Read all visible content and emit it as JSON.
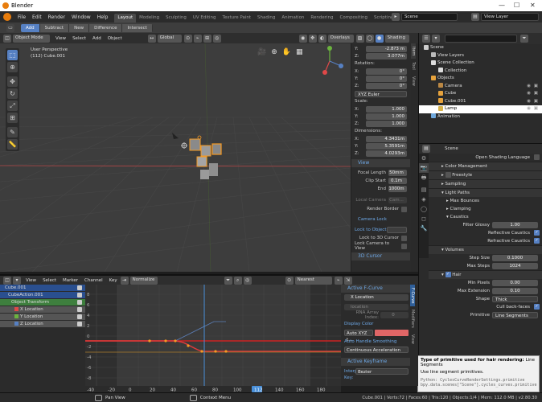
{
  "window": {
    "title": "Blender",
    "controls": [
      "—",
      "☐",
      "✕"
    ]
  },
  "topbar": {
    "menus": [
      "File",
      "Edit",
      "Render",
      "Window",
      "Help"
    ],
    "workspaces": [
      "Layout",
      "Modeling",
      "Sculpting",
      "UV Editing",
      "Texture Paint",
      "Shading",
      "Animation",
      "Rendering",
      "Compositing",
      "Scripting"
    ],
    "scene": "Scene",
    "view_layer": "View Layer"
  },
  "toolsettings": {
    "modes": [
      "Add",
      "Subtract",
      "New",
      "Difference",
      "Intersect"
    ]
  },
  "viewport_header": {
    "mode": "Object Mode",
    "menus": [
      "View",
      "Select",
      "Add",
      "Object"
    ],
    "orientation": "Global",
    "overlays": "Overlays",
    "shading": "Shading"
  },
  "viewport": {
    "perspective": "User Perspective",
    "object": "(112) Cube.001"
  },
  "npanel": {
    "location": [
      {
        "axis": "Y:",
        "value": "-2.8?3 m"
      },
      {
        "axis": "Z:",
        "value": "3.077m"
      }
    ],
    "rotation_label": "Rotation:",
    "rotation": [
      {
        "axis": "X:",
        "value": "0°"
      },
      {
        "axis": "Y:",
        "value": "0°"
      },
      {
        "axis": "Z:",
        "value": "0°"
      }
    ],
    "rotation_mode": "XYZ Euler",
    "scale_label": "Scale:",
    "scale": [
      {
        "axis": "X:",
        "value": "1.000"
      },
      {
        "axis": "Y:",
        "value": "1.000"
      },
      {
        "axis": "Z:",
        "value": "1.000"
      }
    ],
    "dimensions_label": "Dimensions:",
    "dimensions": [
      {
        "axis": "X:",
        "value": "4.3431m"
      },
      {
        "axis": "Y:",
        "value": "5.3591m"
      },
      {
        "axis": "Z:",
        "value": "4.0293m"
      }
    ],
    "view_section": "View",
    "focal_length_label": "Focal Length",
    "focal_length": "50mm",
    "clip_start_label": "Clip Start",
    "clip_start": "0.1m",
    "end_label": "End",
    "end": "1000m",
    "local_camera_label": "Local Camera",
    "local_camera": "Cam...",
    "render_border": "Render Border",
    "camera_lock": "Camera Lock",
    "lock_to_object": "Lock to Object",
    "lock_to_cursor": "Lock to 3D Cursor",
    "lock_camera_to_view": "Lock Camera to View",
    "cursor_section": "3D Cursor",
    "tabs": [
      "Item",
      "Tool",
      "View"
    ]
  },
  "outliner": {
    "rows": [
      {
        "label": "Scene",
        "indent": 0
      },
      {
        "label": "View Layers",
        "indent": 1
      },
      {
        "label": "Scene Collection",
        "indent": 1
      },
      {
        "label": "Collection",
        "indent": 2
      },
      {
        "label": "Objects",
        "indent": 1
      },
      {
        "label": "Camera",
        "indent": 2
      },
      {
        "label": "Cube",
        "indent": 2
      },
      {
        "label": "Cube.001",
        "indent": 2
      },
      {
        "label": "Lamp",
        "indent": 2
      },
      {
        "label": "Animation",
        "indent": 1
      }
    ]
  },
  "properties": {
    "scene": "Scene",
    "open_shading_language": "Open Shading Language",
    "sections": {
      "color_management": "Color Management",
      "freestyle": "Freestyle",
      "sampling": "Sampling",
      "light_paths": "Light Paths",
      "max_bounces": "Max Bounces",
      "clamping": "Clamping",
      "caustics": "Caustics",
      "volumes": "Volumes",
      "hair": "Hair"
    },
    "filter_glossy_label": "Filter Glossy",
    "filter_glossy": "1.00",
    "reflective_caustics": "Reflective Caustics",
    "refractive_caustics": "Refractive Caustics",
    "step_size_label": "Step Size",
    "step_size": "0.1000",
    "max_steps_label": "Max Steps",
    "max_steps": "1024",
    "min_pixels_label": "Min Pixels",
    "min_pixels": "0.00",
    "max_extension_label": "Max Extension",
    "max_extension": "0.10",
    "shape_label": "Shape",
    "shape": "Thick",
    "cull_back_faces": "Cull back-faces",
    "primitive_label": "Primitive",
    "primitive": "Line Segments"
  },
  "tooltip": {
    "title": "Type of primitive used for hair rendering:",
    "value": "Line Segments",
    "desc": "Use line segment primitives.",
    "python1": "Python: CyclesCurveRenderSettings.primitive",
    "python2": "bpy.data.scenes[\"Scene\"].cycles_curves.primitive"
  },
  "graph_header": {
    "menus": [
      "View",
      "Select",
      "Marker",
      "Channel",
      "Key"
    ],
    "normalize": "Normalize",
    "pivot": "Nearest Frame"
  },
  "channels": [
    {
      "label": "Cube.001",
      "color": "#2a4f8f"
    },
    {
      "label": "CubeAction.001",
      "color": "#2a4f8f"
    },
    {
      "label": "Object Transform",
      "color": "#3e7f3e"
    },
    {
      "label": "X Location",
      "color": "#555555"
    },
    {
      "label": "Y Location",
      "color": "#555555"
    },
    {
      "label": "Z Location",
      "color": "#555555"
    }
  ],
  "fcurve_panel": {
    "active_fcurve": "Active F-Curve",
    "channel": "X Location",
    "data_path": "location",
    "rna_label": "RNA Array Index:",
    "rna_index": "0",
    "display_color_label": "Display Color",
    "color_mode": "Auto XYZ t...",
    "auto_handle_label": "Auto Handle Smoothing",
    "auto_handle": "Continuous Acceleration",
    "active_keyframe": "Active Keyframe",
    "interp_label": "Interp",
    "interp": "Bezier",
    "key_label": "Key:",
    "tabs": [
      "F-Curve",
      "Modifiers",
      "View"
    ],
    "curve_color": "#e06666"
  },
  "graph_ruler": {
    "ticks": [
      "-40",
      "-20",
      "0",
      "20",
      "40",
      "60",
      "80",
      "100",
      "112",
      "140",
      "160",
      "180"
    ],
    "current_frame": "112"
  },
  "graph_yaxis": [
    "8",
    "6",
    "4",
    "2",
    "0",
    "-2",
    "-4",
    "-6",
    "-8"
  ],
  "status": {
    "pan": "Pan View",
    "context": "Context Menu",
    "stats": "Cube.001 | Verts:72 | Faces:60 | Tris:120 | Objects:1/4 | Mem: 112.0 MB | v2.80.30"
  }
}
